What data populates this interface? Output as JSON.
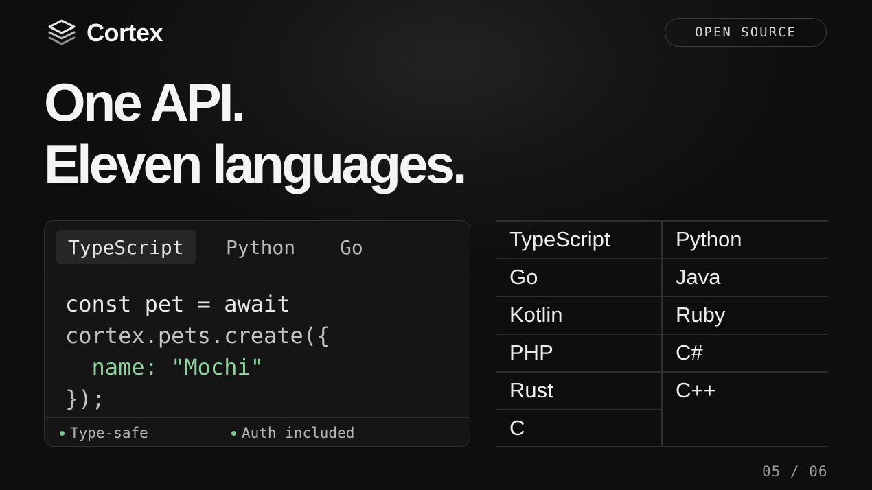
{
  "brand": {
    "name": "Cortex",
    "icon": "layers-icon"
  },
  "badge": {
    "label": "OPEN SOURCE"
  },
  "headline": {
    "line1": "One API.",
    "line2": "Eleven languages."
  },
  "code_card": {
    "tabs": [
      {
        "label": "TypeScript",
        "active": true
      },
      {
        "label": "Python",
        "active": false
      },
      {
        "label": "Go",
        "active": false
      }
    ],
    "code_lines": [
      "const pet = await",
      "cortex.pets.create({",
      "  name: \"Mochi\"",
      "});"
    ],
    "features": [
      "Type-safe",
      "Auth included"
    ]
  },
  "languages": [
    [
      "TypeScript",
      "Python"
    ],
    [
      "Go",
      "Java"
    ],
    [
      "Kotlin",
      "Ruby"
    ],
    [
      "PHP",
      "C#"
    ],
    [
      "Rust",
      "C++"
    ],
    [
      "C",
      ""
    ]
  ],
  "pager": {
    "text": "05 / 06"
  },
  "colors": {
    "accent_green": "#8fd19e",
    "background": "#0f0f0f"
  }
}
